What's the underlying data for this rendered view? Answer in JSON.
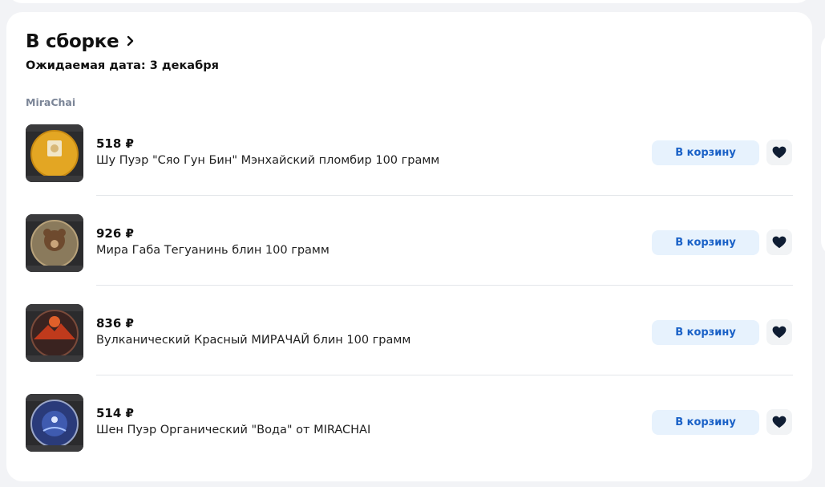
{
  "section": {
    "title": "В сборке",
    "subtitle": "Ожидаемая дата: 3 декабря",
    "seller": "MiraChai"
  },
  "items": [
    {
      "price": "518 ₽",
      "name": "Шу Пуэр \"Сяо Гун Бин\" Мэнхайский пломбир 100 грамм",
      "cart_label": "В корзину",
      "image": "tea-cake-yellow"
    },
    {
      "price": "926 ₽",
      "name": "Мира Габа Тегуанинь блин 100 грамм",
      "cart_label": "В корзину",
      "image": "tea-cake-bear"
    },
    {
      "price": "836 ₽",
      "name": "Вулканический Красный МИРАЧАЙ блин 100 грамм",
      "cart_label": "В корзину",
      "image": "tea-cake-volcano"
    },
    {
      "price": "514 ₽",
      "name": "Шен Пуэр Органический \"Вода\" от MIRACHAI",
      "cart_label": "В корзину",
      "image": "tea-cake-water"
    }
  ],
  "colors": {
    "accent_text": "#1a61c7",
    "button_bg": "#e7f2fd",
    "heart": "#0f1d33"
  }
}
